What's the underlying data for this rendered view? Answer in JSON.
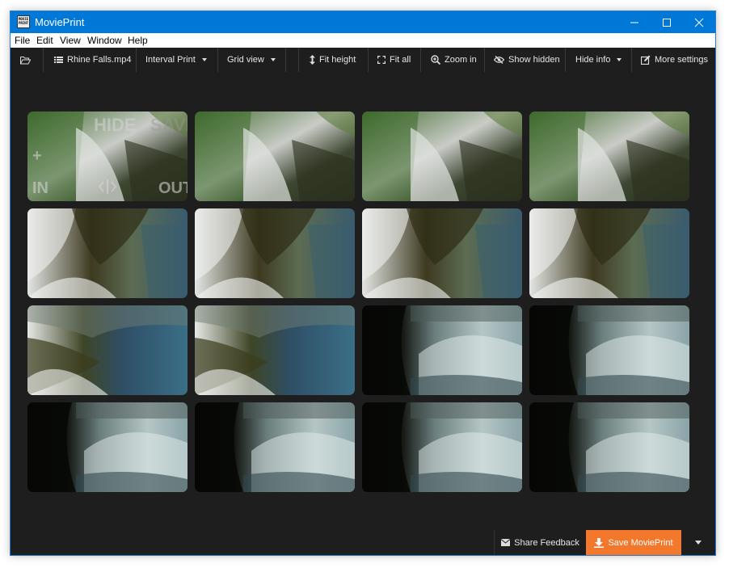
{
  "window": {
    "title": "MoviePrint",
    "icon_text": "MOVIE PRINT"
  },
  "menu": [
    "File",
    "Edit",
    "View",
    "Window",
    "Help"
  ],
  "toolbar": {
    "file": "Rhine Falls.mp4",
    "print_mode": "Interval Print",
    "view_mode": "Grid view",
    "fit_height": "Fit height",
    "fit_all": "Fit all",
    "zoom_in": "Zoom in",
    "show_hidden": "Show hidden",
    "hide_info": "Hide info",
    "more_settings": "More settings"
  },
  "thumb_overlay": {
    "hide": "HIDE",
    "save": "SAVE",
    "plus": "+",
    "in": "IN",
    "out": "OUT"
  },
  "thumbnails": [
    {
      "kind": "cascade"
    },
    {
      "kind": "cascade"
    },
    {
      "kind": "cascade"
    },
    {
      "kind": "cascade"
    },
    {
      "kind": "rocks"
    },
    {
      "kind": "rocks"
    },
    {
      "kind": "rocks"
    },
    {
      "kind": "rocks"
    },
    {
      "kind": "river"
    },
    {
      "kind": "river"
    },
    {
      "kind": "spray"
    },
    {
      "kind": "spray"
    },
    {
      "kind": "spray"
    },
    {
      "kind": "spray"
    },
    {
      "kind": "spray"
    },
    {
      "kind": "spray"
    }
  ],
  "bottom": {
    "feedback": "Share Feedback",
    "save": "Save MoviePrint"
  },
  "colors": {
    "titlebar": "#0078d7",
    "background": "#1e1e1e",
    "save_button": "#f3782b"
  }
}
